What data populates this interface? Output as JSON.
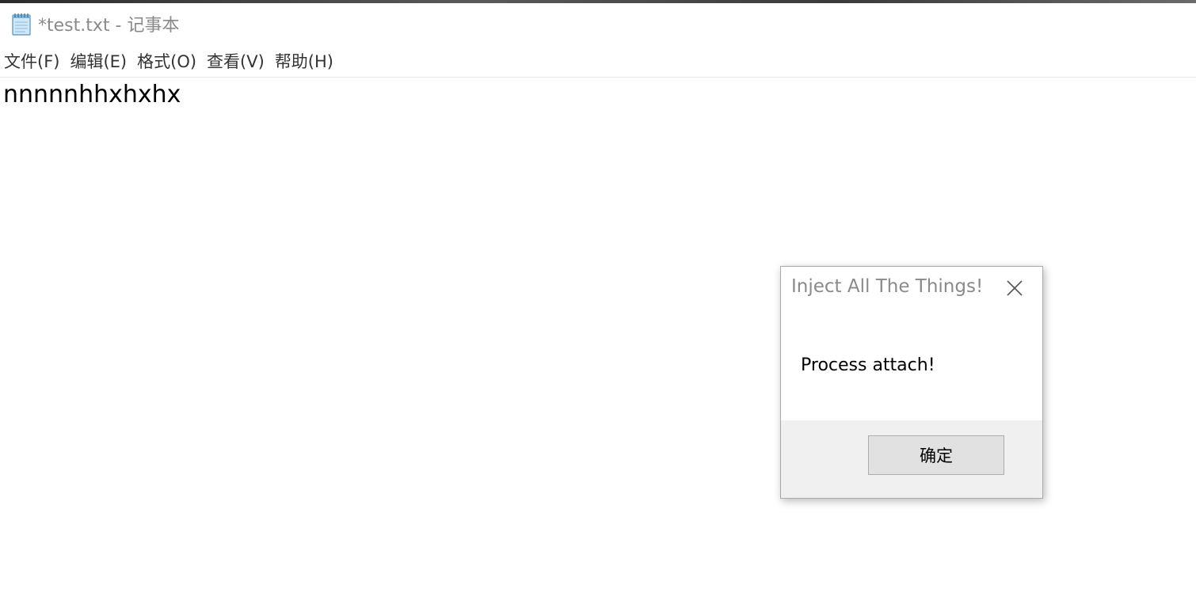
{
  "window": {
    "title": "*test.txt - 记事本",
    "app_icon": "notepad-icon"
  },
  "menubar": {
    "items": [
      {
        "label": "文件(F)"
      },
      {
        "label": "编辑(E)"
      },
      {
        "label": "格式(O)"
      },
      {
        "label": "查看(V)"
      },
      {
        "label": "帮助(H)"
      }
    ]
  },
  "editor": {
    "content": "nnnnnhhxhxhx"
  },
  "dialog": {
    "title": "Inject All The Things!",
    "message": "Process attach!",
    "ok_label": "确定",
    "close_icon": "close-icon"
  },
  "colors": {
    "title_text": "#8a8a8a",
    "dialog_footer": "#f0f0f0",
    "button_face": "#e1e1e1"
  }
}
